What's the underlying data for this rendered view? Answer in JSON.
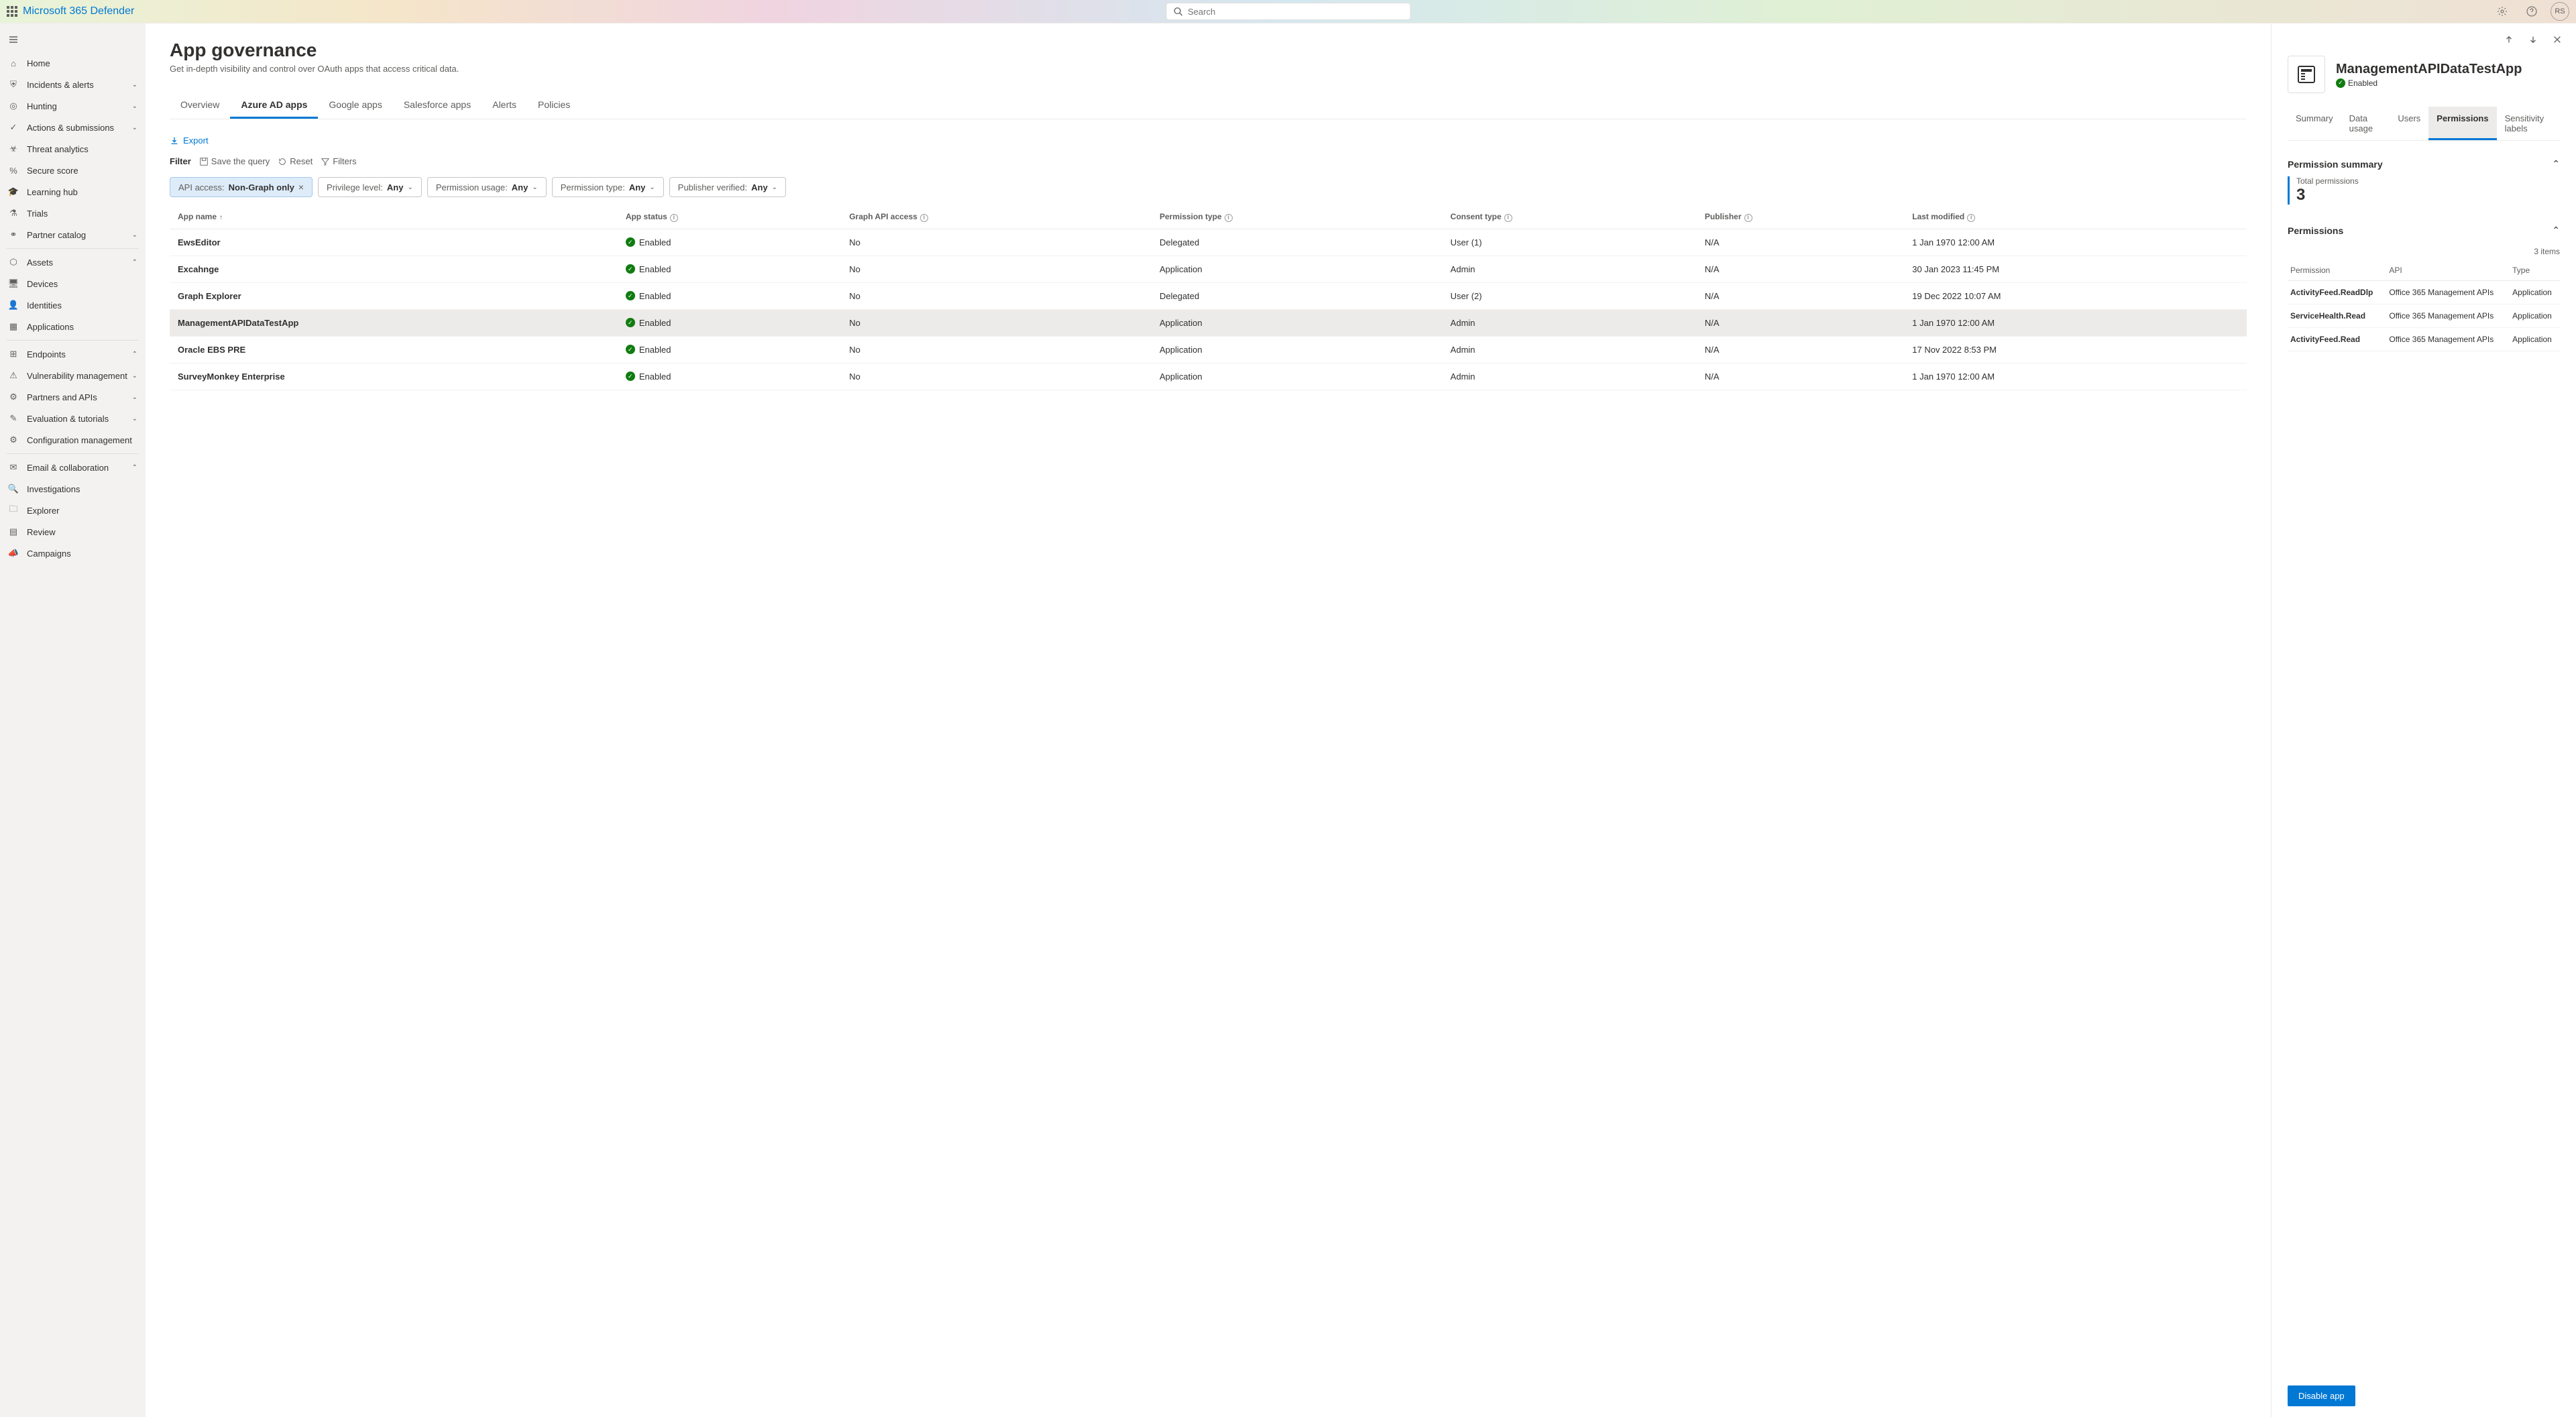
{
  "header": {
    "app_title": "Microsoft 365 Defender",
    "search_placeholder": "Search",
    "avatar_initials": "RS"
  },
  "sidebar": {
    "items": [
      {
        "label": "Home",
        "icon": "home",
        "expandable": false
      },
      {
        "label": "Incidents & alerts",
        "icon": "shield",
        "expandable": true
      },
      {
        "label": "Hunting",
        "icon": "target",
        "expandable": true
      },
      {
        "label": "Actions & submissions",
        "icon": "check-clock",
        "expandable": true
      },
      {
        "label": "Threat analytics",
        "icon": "threat",
        "expandable": false
      },
      {
        "label": "Secure score",
        "icon": "score",
        "expandable": false
      },
      {
        "label": "Learning hub",
        "icon": "learn",
        "expandable": false
      },
      {
        "label": "Trials",
        "icon": "flask",
        "expandable": false
      },
      {
        "label": "Partner catalog",
        "icon": "partner",
        "expandable": true
      }
    ],
    "assets_header": "Assets",
    "assets_items": [
      {
        "label": "Devices",
        "icon": "device"
      },
      {
        "label": "Identities",
        "icon": "identity"
      },
      {
        "label": "Applications",
        "icon": "apps"
      }
    ],
    "endpoints_header": "Endpoints",
    "endpoints_items": [
      {
        "label": "Vulnerability management",
        "icon": "vuln",
        "expandable": true
      },
      {
        "label": "Partners and APIs",
        "icon": "api",
        "expandable": true
      },
      {
        "label": "Evaluation & tutorials",
        "icon": "eval",
        "expandable": true
      },
      {
        "label": "Configuration management",
        "icon": "config",
        "expandable": false
      }
    ],
    "email_header": "Email & collaboration",
    "email_items": [
      {
        "label": "Investigations",
        "icon": "investigate"
      },
      {
        "label": "Explorer",
        "icon": "explorer"
      },
      {
        "label": "Review",
        "icon": "review"
      },
      {
        "label": "Campaigns",
        "icon": "campaign"
      }
    ]
  },
  "page": {
    "title": "App governance",
    "subtitle": "Get in-depth visibility and control over OAuth apps that access critical data."
  },
  "tabs": [
    {
      "label": "Overview",
      "active": false
    },
    {
      "label": "Azure AD apps",
      "active": true
    },
    {
      "label": "Google apps",
      "active": false
    },
    {
      "label": "Salesforce apps",
      "active": false
    },
    {
      "label": "Alerts",
      "active": false
    },
    {
      "label": "Policies",
      "active": false
    }
  ],
  "toolbar": {
    "export_label": "Export",
    "filter_label": "Filter",
    "save_query_label": "Save the query",
    "reset_label": "Reset",
    "filters_label": "Filters"
  },
  "filter_chips": [
    {
      "label": "API access:",
      "value": "Non-Graph only",
      "closable": true,
      "active": true
    },
    {
      "label": "Privilege level:",
      "value": "Any",
      "closable": false,
      "active": false
    },
    {
      "label": "Permission usage:",
      "value": "Any",
      "closable": false,
      "active": false
    },
    {
      "label": "Permission type:",
      "value": "Any",
      "closable": false,
      "active": false
    },
    {
      "label": "Publisher verified:",
      "value": "Any",
      "closable": false,
      "active": false
    }
  ],
  "table": {
    "columns": [
      "App name",
      "App status",
      "Graph API access",
      "Permission type",
      "Consent type",
      "Publisher",
      "Last modified"
    ],
    "rows": [
      {
        "name": "EwsEditor",
        "status": "Enabled",
        "graph": "No",
        "ptype": "Delegated",
        "ctype": "User (1)",
        "publisher": "N/A",
        "modified": "1 Jan 1970 12:00 AM",
        "selected": false
      },
      {
        "name": "Excahnge",
        "status": "Enabled",
        "graph": "No",
        "ptype": "Application",
        "ctype": "Admin",
        "publisher": "N/A",
        "modified": "30 Jan 2023 11:45 PM",
        "selected": false
      },
      {
        "name": "Graph Explorer",
        "status": "Enabled",
        "graph": "No",
        "ptype": "Delegated",
        "ctype": "User (2)",
        "publisher": "N/A",
        "modified": "19 Dec 2022 10:07 AM",
        "selected": false
      },
      {
        "name": "ManagementAPIDataTestApp",
        "status": "Enabled",
        "graph": "No",
        "ptype": "Application",
        "ctype": "Admin",
        "publisher": "N/A",
        "modified": "1 Jan 1970 12:00 AM",
        "selected": true
      },
      {
        "name": "Oracle EBS PRE",
        "status": "Enabled",
        "graph": "No",
        "ptype": "Application",
        "ctype": "Admin",
        "publisher": "N/A",
        "modified": "17 Nov 2022 8:53 PM",
        "selected": false
      },
      {
        "name": "SurveyMonkey Enterprise",
        "status": "Enabled",
        "graph": "No",
        "ptype": "Application",
        "ctype": "Admin",
        "publisher": "N/A",
        "modified": "1 Jan 1970 12:00 AM",
        "selected": false
      }
    ]
  },
  "panel": {
    "app_name": "ManagementAPIDataTestApp",
    "app_status": "Enabled",
    "tabs": [
      {
        "label": "Summary",
        "active": false
      },
      {
        "label": "Data usage",
        "active": false
      },
      {
        "label": "Users",
        "active": false
      },
      {
        "label": "Permissions",
        "active": true
      },
      {
        "label": "Sensitivity labels",
        "active": false
      }
    ],
    "summary_section_title": "Permission summary",
    "total_permissions_label": "Total permissions",
    "total_permissions_value": "3",
    "permissions_section_title": "Permissions",
    "items_count": "3 items",
    "perm_columns": [
      "Permission",
      "API",
      "Type"
    ],
    "perm_rows": [
      {
        "perm": "ActivityFeed.ReadDlp",
        "api": "Office 365 Management APIs",
        "type": "Application"
      },
      {
        "perm": "ServiceHealth.Read",
        "api": "Office 365 Management APIs",
        "type": "Application"
      },
      {
        "perm": "ActivityFeed.Read",
        "api": "Office 365 Management APIs",
        "type": "Application"
      }
    ],
    "disable_label": "Disable app"
  }
}
